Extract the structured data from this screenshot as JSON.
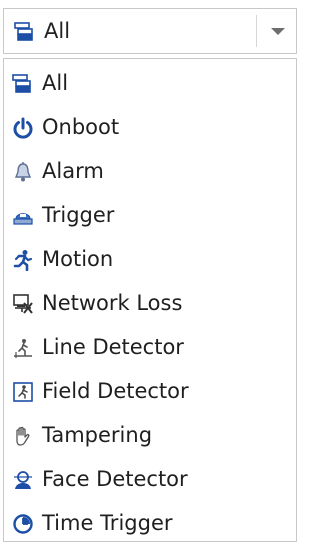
{
  "select": {
    "selected_label": "All",
    "selected_icon": "all-events-icon"
  },
  "options": [
    {
      "label": "All",
      "icon": "all-events-icon"
    },
    {
      "label": "Onboot",
      "icon": "power-icon"
    },
    {
      "label": "Alarm",
      "icon": "bell-icon"
    },
    {
      "label": "Trigger",
      "icon": "trigger-icon"
    },
    {
      "label": "Motion",
      "icon": "running-person-icon"
    },
    {
      "label": "Network Loss",
      "icon": "network-loss-icon"
    },
    {
      "label": "Line Detector",
      "icon": "line-crossing-icon"
    },
    {
      "label": "Field Detector",
      "icon": "field-detector-icon"
    },
    {
      "label": "Tampering",
      "icon": "hand-icon"
    },
    {
      "label": "Face Detector",
      "icon": "face-detector-icon"
    },
    {
      "label": "Time Trigger",
      "icon": "clock-icon"
    }
  ],
  "colors": {
    "icon_blue": "#1d4fa6",
    "icon_gray": "#7a7a7a",
    "border": "#c8c8c8"
  }
}
